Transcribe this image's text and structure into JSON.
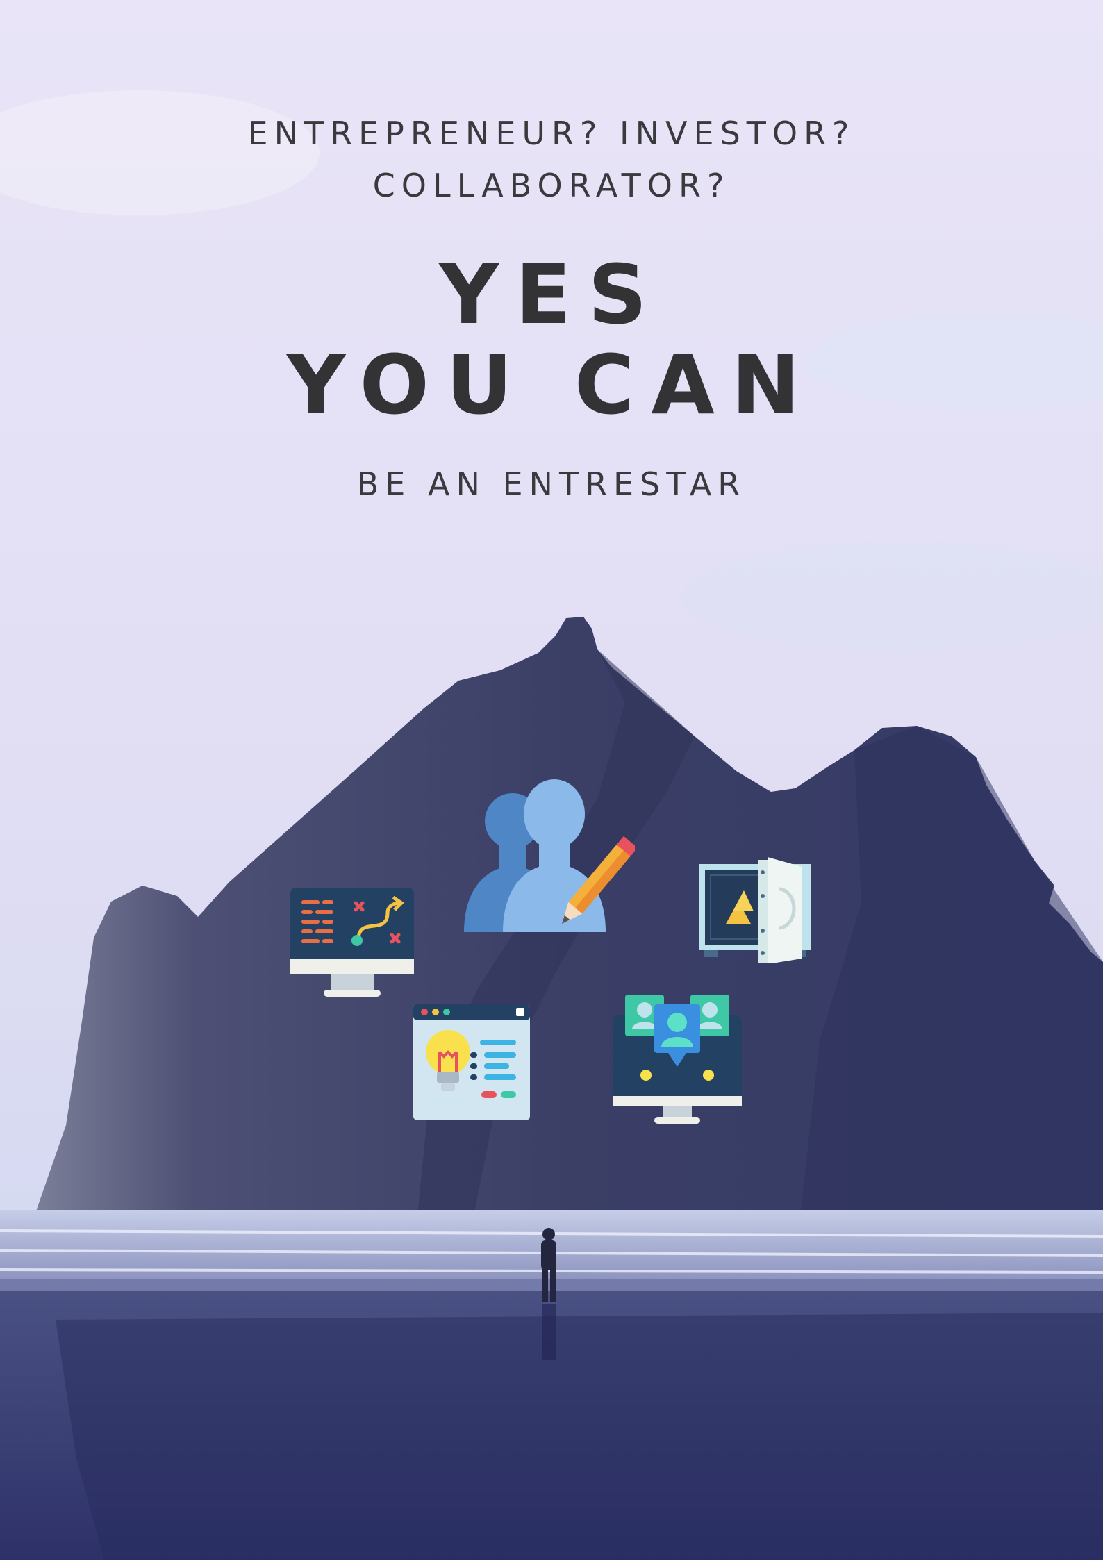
{
  "poster": {
    "questions": [
      "ENTREPRENEUR? INVESTOR?",
      "COLLABORATOR?"
    ],
    "headline": [
      "YES",
      "YOU CAN"
    ],
    "subheadline": "BE AN ENTRESTAR",
    "icons": [
      "strategy-monitor-icon",
      "users-edit-icon",
      "open-safe-icon",
      "idea-browser-icon",
      "team-monitor-icon"
    ],
    "colors": {
      "sky_top": "#e7e2f6",
      "sky_bottom": "#ced6ee",
      "mountain": "#383c64",
      "water": "#3a4072",
      "text": "#333335"
    }
  }
}
